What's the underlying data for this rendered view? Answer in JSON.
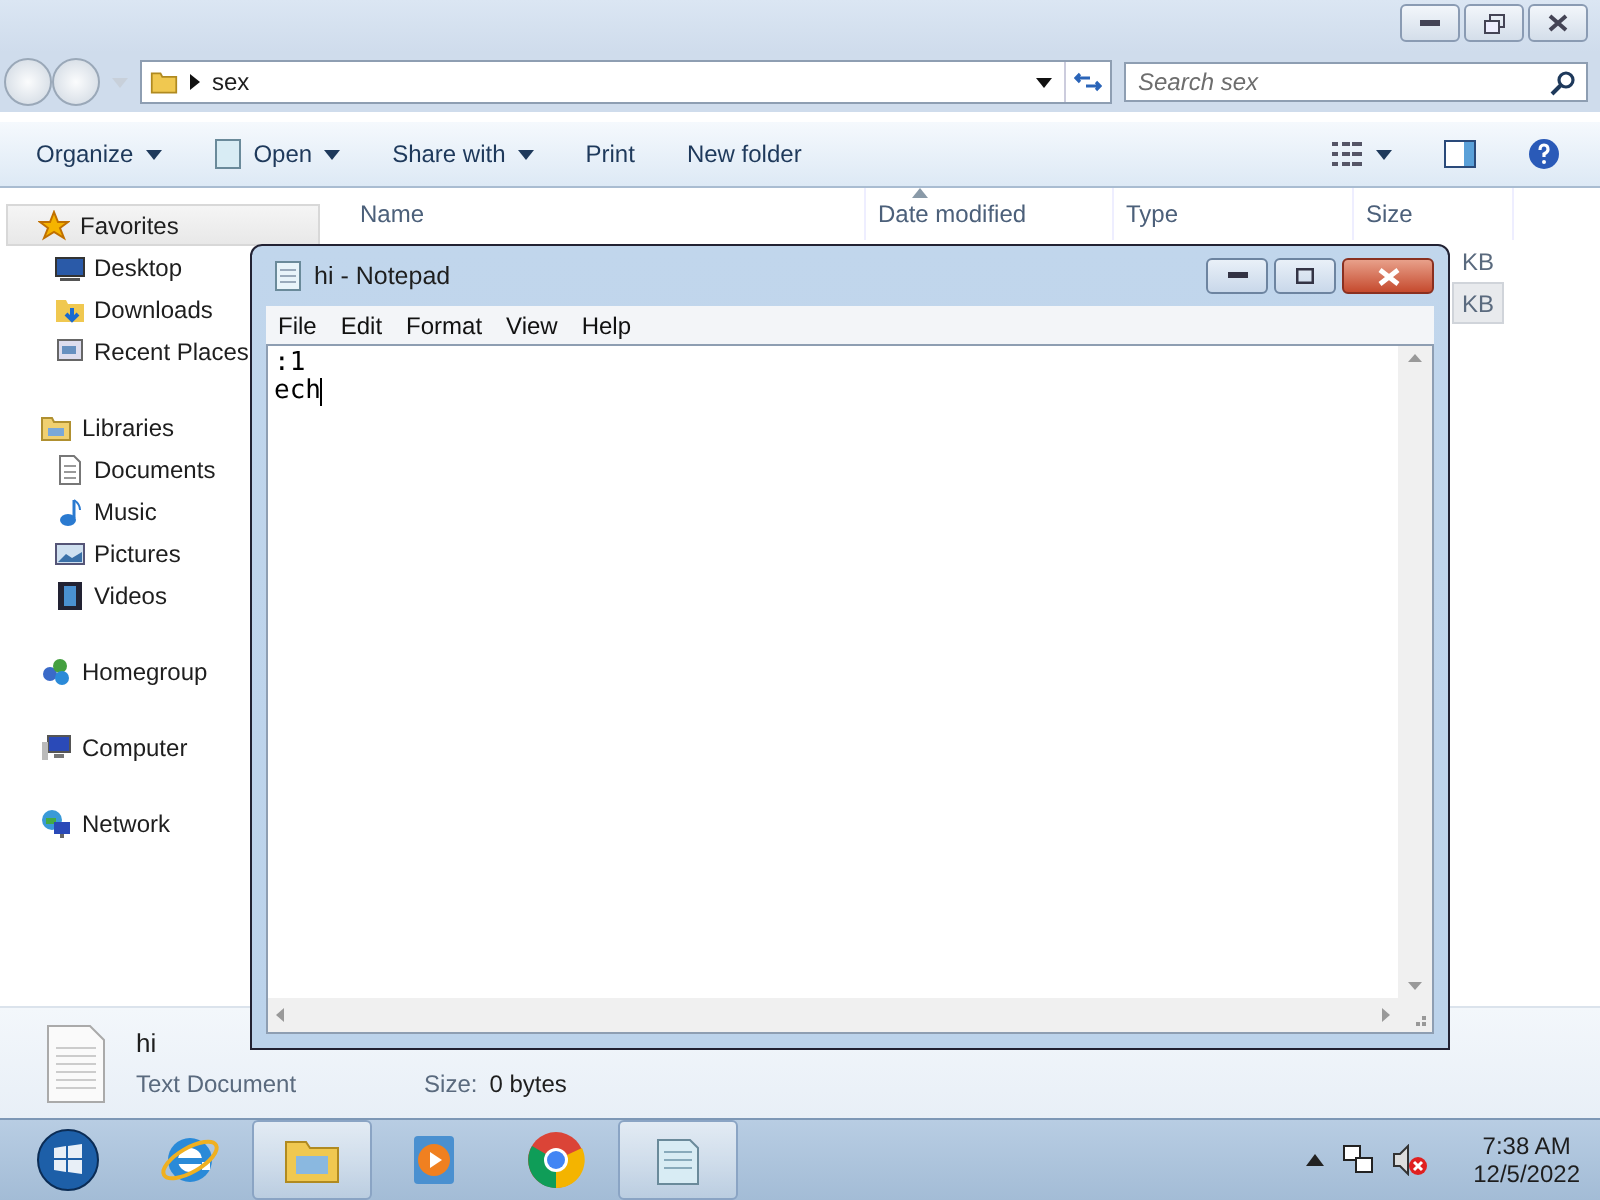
{
  "explorer": {
    "address": {
      "path": "sex"
    },
    "search": {
      "placeholder": "Search sex"
    },
    "toolbar": [
      {
        "label": "Organize",
        "dropdown": true
      },
      {
        "label": "Open",
        "dropdown": true
      },
      {
        "label": "Share with",
        "dropdown": true
      },
      {
        "label": "Print",
        "dropdown": false
      },
      {
        "label": "New folder",
        "dropdown": false
      }
    ],
    "navigation": [
      {
        "label": "Favorites",
        "selected": true,
        "children": [
          {
            "label": "Desktop"
          },
          {
            "label": "Downloads"
          },
          {
            "label": "Recent Places"
          }
        ]
      },
      {
        "label": "Libraries",
        "selected": false,
        "children": [
          {
            "label": "Documents"
          },
          {
            "label": "Music"
          },
          {
            "label": "Pictures"
          },
          {
            "label": "Videos"
          }
        ]
      },
      {
        "label": "Homegroup",
        "selected": false
      },
      {
        "label": "Computer",
        "selected": false
      },
      {
        "label": "Network",
        "selected": false
      }
    ],
    "columns": [
      "Name",
      "Date modified",
      "Type",
      "Size"
    ],
    "rows": [
      {
        "size": "KB",
        "selected": false
      },
      {
        "size": "KB",
        "selected": true
      }
    ],
    "details": {
      "name": "hi",
      "type": "Text Document",
      "size_label": "Size:",
      "size": "0 bytes"
    }
  },
  "notepad": {
    "title": "hi - Notepad",
    "menu": [
      "File",
      "Edit",
      "Format",
      "View",
      "Help"
    ],
    "text": ":1\nech"
  },
  "taskbar": {
    "apps": [
      {
        "selected": false
      },
      {
        "selected": true
      },
      {
        "selected": false
      },
      {
        "selected": false
      },
      {
        "selected": true
      }
    ],
    "time": "7:38 AM",
    "date": "12/5/2022"
  }
}
